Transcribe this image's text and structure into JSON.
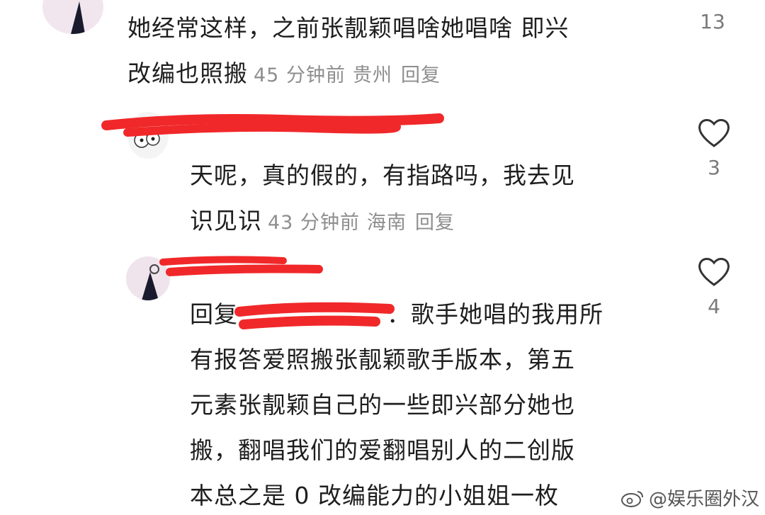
{
  "comments": [
    {
      "text_line1": "她经常这样，之前张靓颖唱啥她唱啥 即兴",
      "text_line2": "改编也照搬",
      "time": "45 分钟前",
      "location": "贵州",
      "reply_label": "回复",
      "likes": "13",
      "icon": "heart-icon"
    },
    {
      "text_line1": "天呢，真的假的，有指路吗，我去见",
      "text_line2": "识见识",
      "time": "43 分钟前",
      "location": "海南",
      "reply_label": "回复",
      "likes": "3",
      "icon": "heart-icon"
    },
    {
      "reply_prefix": "回复",
      "text_lines": [
        "：歌手她唱的我用所",
        "有报答爱照搬张靓颖歌手版本，第五",
        "元素张靓颖自己的一些即兴部分她也",
        "搬，翻唱我们的爱翻唱别人的二创版",
        "本总之是 0 改编能力的小姐姐一枚"
      ],
      "likes": "4",
      "icon": "heart-icon"
    }
  ],
  "watermark": {
    "icon": "weibo-icon",
    "text": "@娱乐圈外汉"
  },
  "colors": {
    "redaction": "#f0282a",
    "meta": "#8e8e8e",
    "text": "#1e1e1e"
  }
}
